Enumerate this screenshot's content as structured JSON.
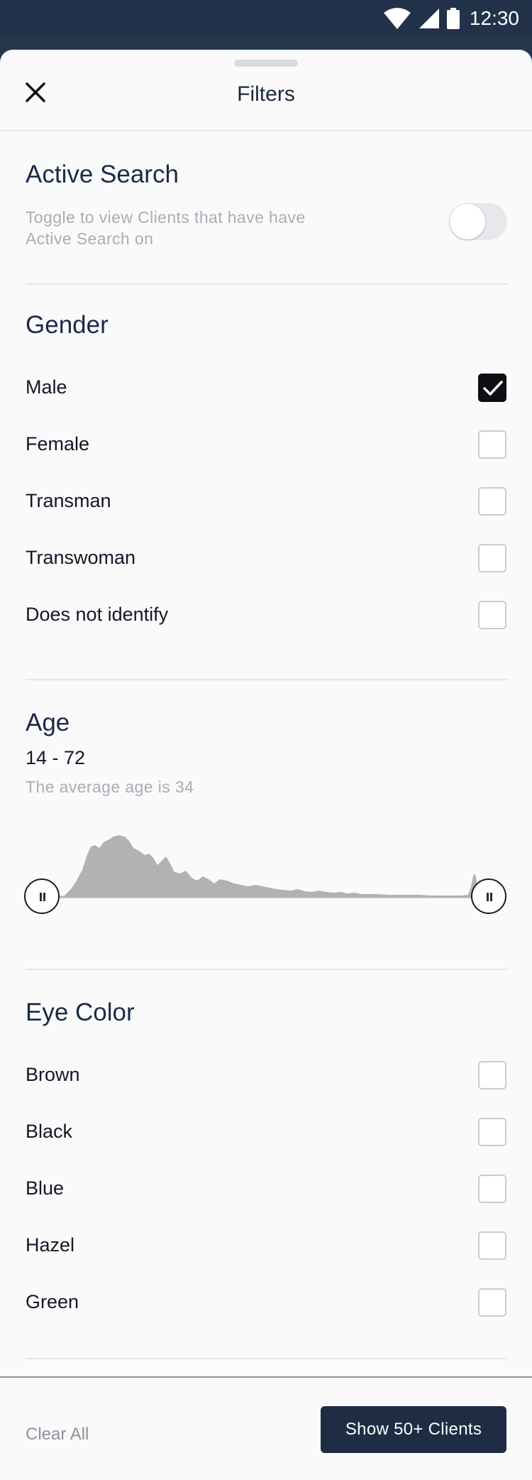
{
  "status_bar": {
    "time": "12:30",
    "icons": [
      "wifi-icon",
      "cellular-signal-icon",
      "battery-icon"
    ]
  },
  "sheet": {
    "title": "Filters",
    "close_icon": "close-icon"
  },
  "active_search": {
    "title": "Active Search",
    "description_line1": "Toggle to view Clients that have have",
    "description_line2": "Active Search on",
    "toggle_on": false
  },
  "gender": {
    "title": "Gender",
    "options": [
      {
        "label": "Male",
        "checked": true
      },
      {
        "label": "Female",
        "checked": false
      },
      {
        "label": "Transman",
        "checked": false
      },
      {
        "label": "Transwoman",
        "checked": false
      },
      {
        "label": "Does not identify",
        "checked": false
      }
    ]
  },
  "age": {
    "title": "Age",
    "range_text": "14 - 72",
    "average_text": "The average age is 34",
    "range_min": 14,
    "range_max": 72
  },
  "eye_color": {
    "title": "Eye Color",
    "options": [
      {
        "label": "Brown",
        "checked": false
      },
      {
        "label": "Black",
        "checked": false
      },
      {
        "label": "Blue",
        "checked": false
      },
      {
        "label": "Hazel",
        "checked": false
      },
      {
        "label": "Green",
        "checked": false
      }
    ]
  },
  "footer": {
    "clear_all_label": "Clear All",
    "show_button_label": "Show 50+ Clients"
  },
  "colors": {
    "primary_dark": "#1e2d43",
    "status_bar": "#22324a",
    "histogram_fill": "#b2b2b2"
  }
}
